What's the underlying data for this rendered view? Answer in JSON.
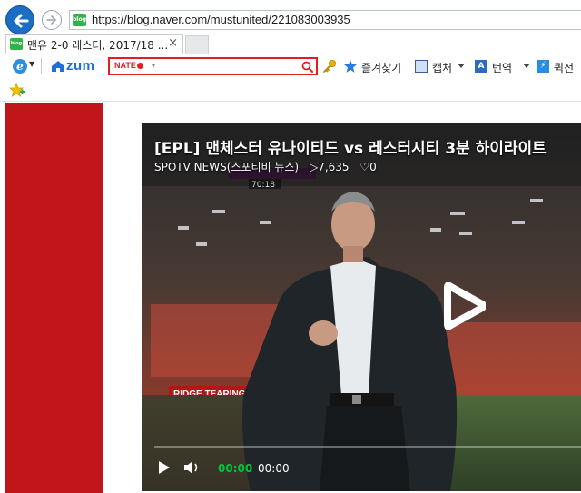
{
  "browser": {
    "url": "https://blog.naver.com/mustunited/221083003935",
    "site_favicon_label": "blog",
    "tab": {
      "title": "맨유 2-0 레스터, 2017/18 ...",
      "close": "×"
    },
    "toolbar": {
      "zum_label": "zum",
      "nate_label": "NATE",
      "favorites_label": "즐겨찾기",
      "capture_label": "캡처",
      "translate_label": "번역",
      "quick_label": "퀵전"
    }
  },
  "video": {
    "title": "[EPL] 맨체스터 유나이티드 vs 레스터시티 3분 하이라이트",
    "channel": "SPOTV NEWS(스포티비 뉴스)",
    "views": "▷7,635",
    "likes": "♡0",
    "scoreboard_time": "70:18",
    "banner_text": "RIDGE  TEARING YOU APA",
    "current_time": "00:00",
    "duration": "00:00",
    "progress": 0
  },
  "colors": {
    "brand_red": "#c0151b",
    "time_green": "#00c73c",
    "link_blue": "#1f6fd8"
  }
}
